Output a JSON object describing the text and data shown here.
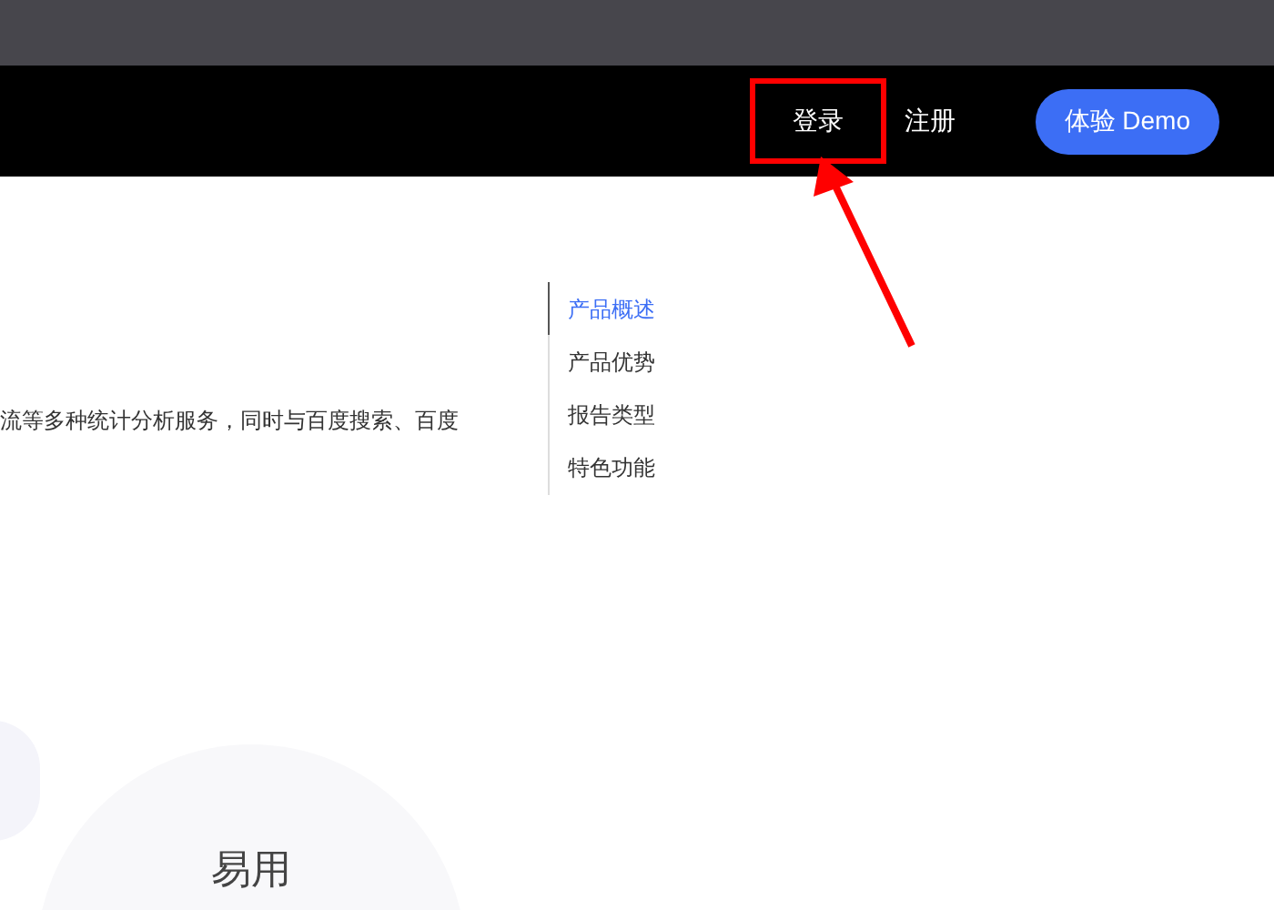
{
  "nav": {
    "links": [
      {
        "label": "登录",
        "highlighted": true
      },
      {
        "label": "注册",
        "highlighted": false
      }
    ],
    "demo_button": "体验 Demo"
  },
  "intro": {
    "text": "流等多种统计分析服务，同时与百度搜索、百度"
  },
  "toc": [
    {
      "label": "产品概述",
      "selected": true
    },
    {
      "label": "产品优势",
      "selected": false
    },
    {
      "label": "报告类型",
      "selected": false
    },
    {
      "label": "特色功能",
      "selected": false
    }
  ],
  "feature": {
    "title": "易用"
  }
}
